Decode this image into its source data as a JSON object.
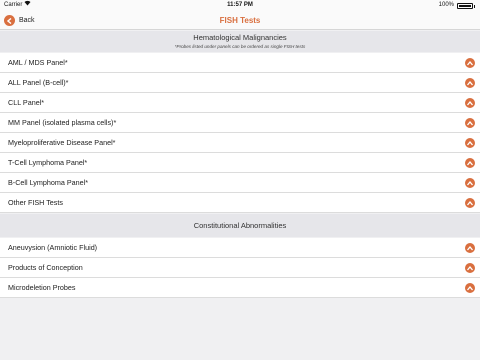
{
  "status_bar": {
    "carrier": "Carrier",
    "time": "11:57 PM",
    "battery": "100%"
  },
  "nav": {
    "back_label": "Back",
    "title": "FISH Tests"
  },
  "sections": [
    {
      "title": "Hematological Malignancies",
      "note": "*Probes listed under panels can be ordered as single FISH tests",
      "items": [
        "AML / MDS Panel*",
        "ALL Panel (B-cell)*",
        "CLL Panel*",
        "MM Panel (isolated plasma cells)*",
        "Myeloproliferative Disease Panel*",
        "T-Cell Lymphoma Panel*",
        "B-Cell Lymphoma Panel*",
        "Other FISH Tests"
      ]
    },
    {
      "title": "Constitutional Abnormalities",
      "items": [
        "Aneuvysion (Amniotic Fluid)",
        "Products of Conception",
        "Microdeletion Probes"
      ]
    }
  ],
  "colors": {
    "accent": "#d96f3f",
    "section_bg": "#e6e6ea",
    "page_bg": "#f0f0f2"
  }
}
